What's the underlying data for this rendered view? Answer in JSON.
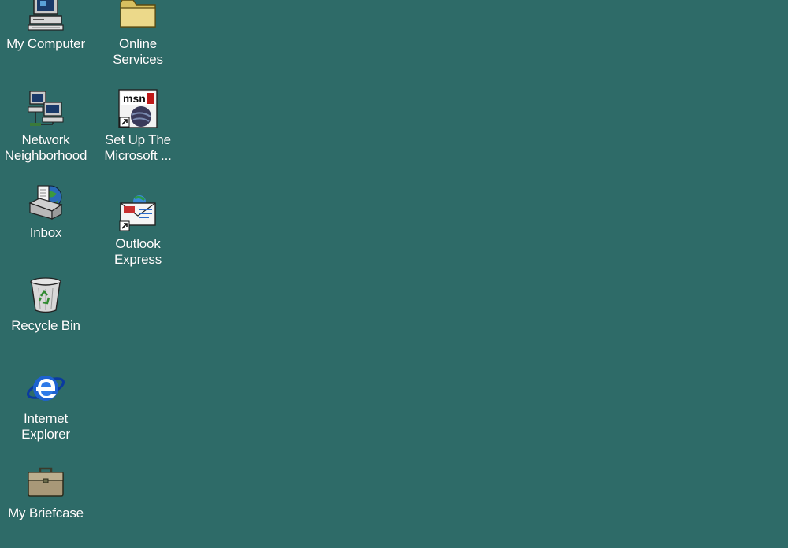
{
  "desktop": {
    "background_color": "#2e6b68",
    "icons": [
      {
        "label": "My Computer",
        "icon": "computer-icon"
      },
      {
        "label": "Network\nNeighborhood",
        "icon": "network-icon"
      },
      {
        "label": "Inbox",
        "icon": "inbox-icon"
      },
      {
        "label": "Recycle Bin",
        "icon": "recycle-bin-icon"
      },
      {
        "label": "Internet\nExplorer",
        "icon": "internet-explorer-icon"
      },
      {
        "label": "My Briefcase",
        "icon": "briefcase-icon"
      },
      {
        "label": "Online\nServices",
        "icon": "folder-icon"
      },
      {
        "label": "Set Up The\nMicrosoft ...",
        "icon": "msn-icon"
      },
      {
        "label": "Outlook\nExpress",
        "icon": "outlook-express-icon"
      }
    ]
  }
}
